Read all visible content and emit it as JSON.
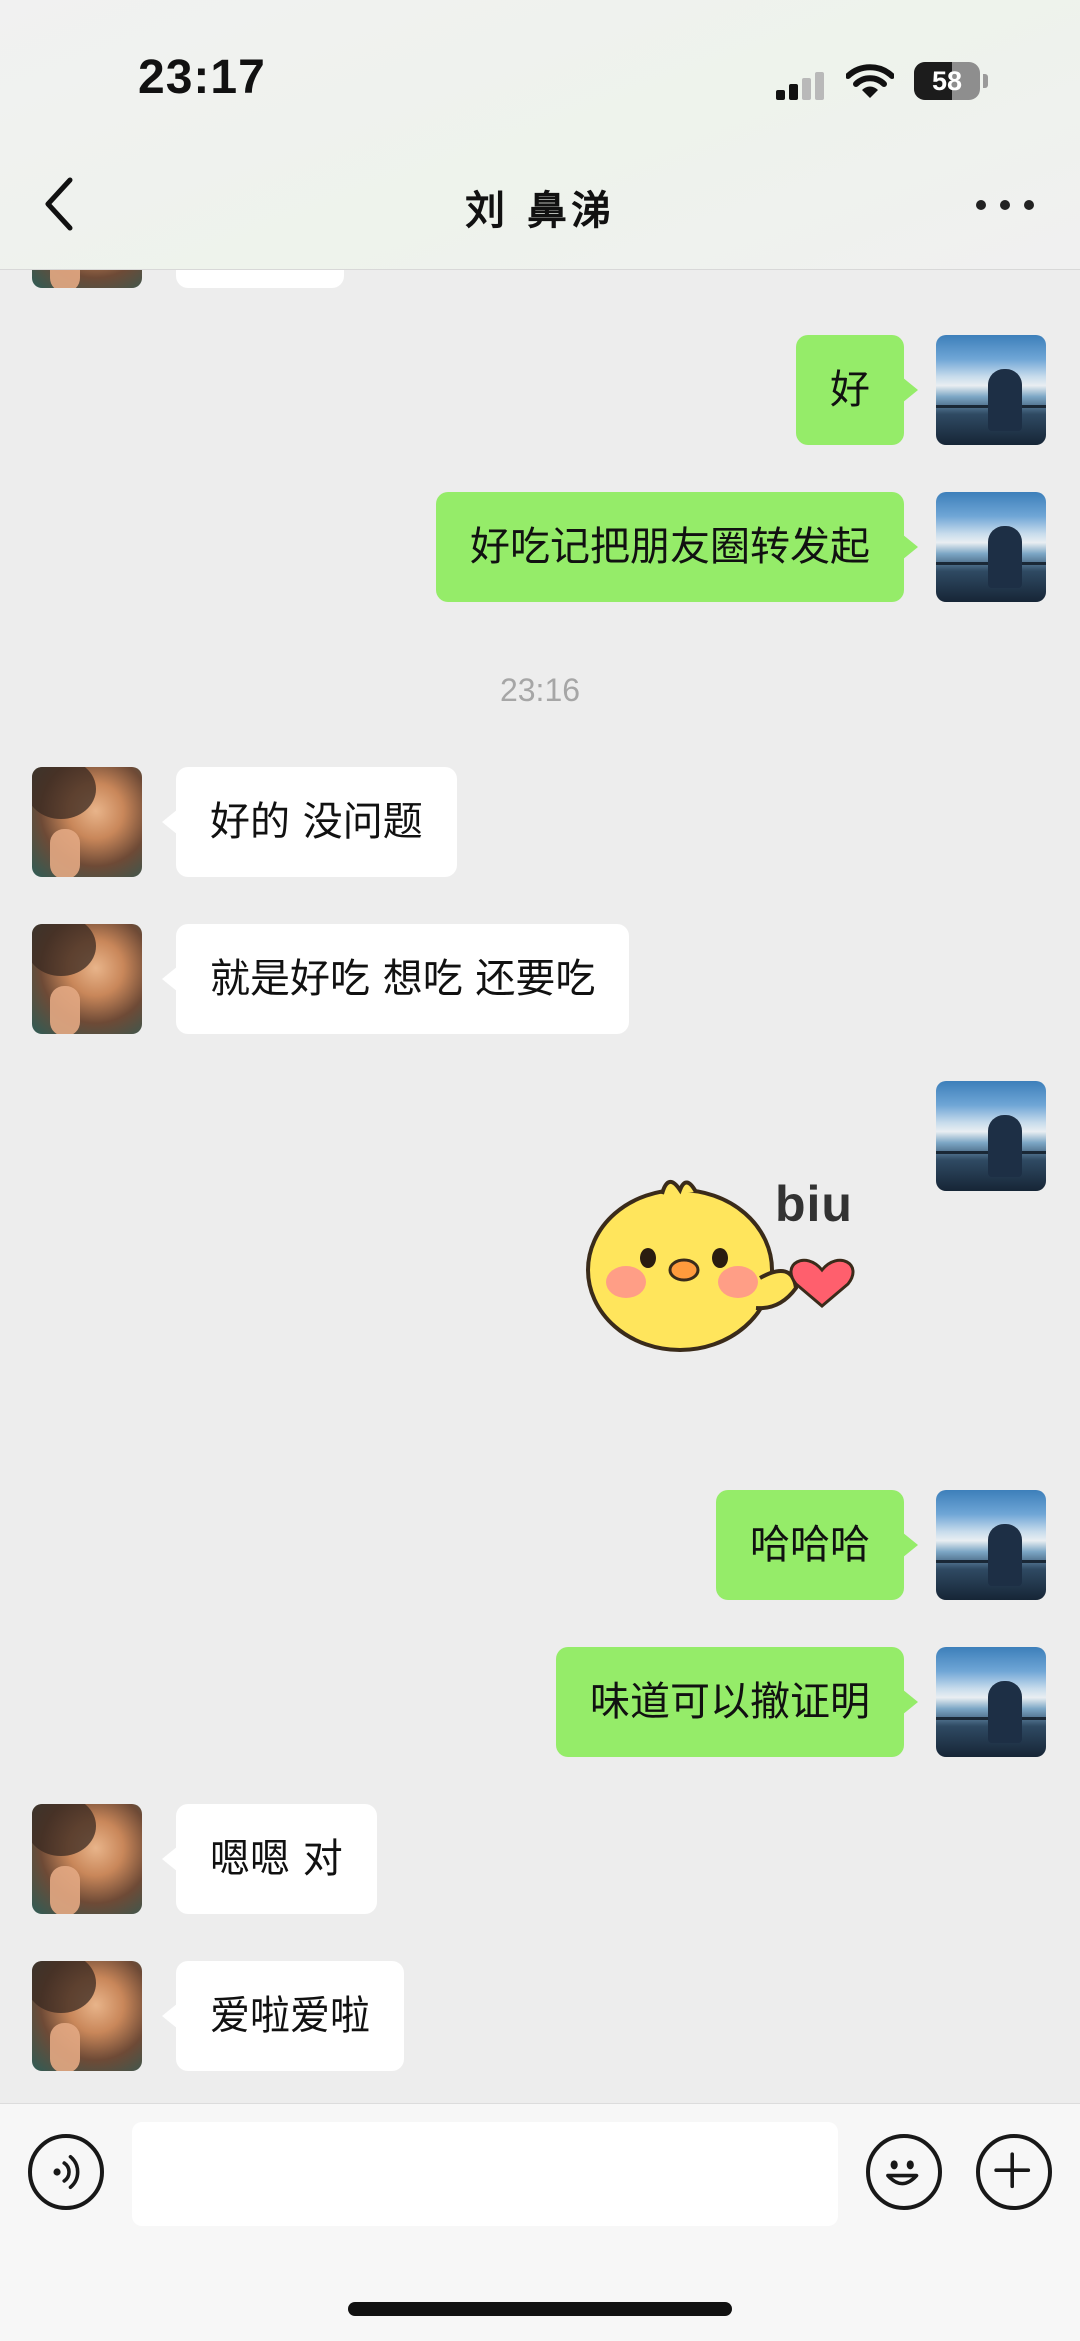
{
  "status_bar": {
    "time": "23:17",
    "battery_percent": "58"
  },
  "header": {
    "title": "刘 鼻涕"
  },
  "messages": [
    {
      "sender": "me",
      "type": "text",
      "text": "好"
    },
    {
      "sender": "me",
      "type": "text",
      "text": "好吃记把朋友圈转发起"
    },
    {
      "type": "timestamp",
      "text": "23:16"
    },
    {
      "sender": "other",
      "type": "text",
      "text": "好的 没问题"
    },
    {
      "sender": "other",
      "type": "text",
      "text": "就是好吃 想吃 还要吃"
    },
    {
      "sender": "me",
      "type": "sticker",
      "text": "biu"
    },
    {
      "sender": "me",
      "type": "text",
      "text": "哈哈哈"
    },
    {
      "sender": "me",
      "type": "text",
      "text": "味道可以撤证明"
    },
    {
      "sender": "other",
      "type": "text",
      "text": "嗯嗯 对"
    },
    {
      "sender": "other",
      "type": "text",
      "text": "爱啦爱啦"
    }
  ],
  "input": {
    "value": "",
    "placeholder": ""
  },
  "icons": {
    "back": "chevron-left-icon",
    "more": "more-horizontal-icon",
    "voice": "voice-icon",
    "emoji": "emoji-icon",
    "add": "plus-icon"
  },
  "colors": {
    "bubble_me": "#95ec69",
    "bubble_other": "#ffffff",
    "background": "#ededed"
  }
}
